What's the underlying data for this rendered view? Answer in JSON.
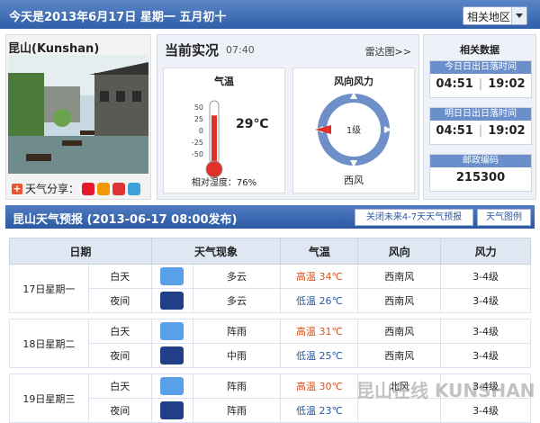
{
  "header": {
    "date_text": "今天是2013年6月17日  星期一  五月初十",
    "region_select": "相关地区"
  },
  "city": {
    "name": "昆山(Kunshan)",
    "share_label": "天气分享："
  },
  "now": {
    "title": "当前实况",
    "time": "07:40",
    "radar_link": "雷达图>>",
    "temp_title": "气温",
    "temp_value": "29℃",
    "temp_ticks": [
      "50",
      "25",
      "0",
      "-25",
      "-50"
    ],
    "humidity": "相对湿度：76%",
    "wind_title": "风向风力",
    "wind_level": "1级",
    "wind_dir": "西风",
    "temp_fraction": 0.79
  },
  "related": {
    "title": "相关数据",
    "sun_today_label": "今日日出日落时间",
    "sunrise_today": "04:51",
    "sunset_today": "19:02",
    "sun_tomorrow_label": "明日日出日落时间",
    "sunrise_tomorrow": "04:51",
    "sunset_tomorrow": "19:02",
    "zip_label": "邮政编码",
    "zip": "215300"
  },
  "forecast": {
    "title": "昆山天气预报  (2013-06-17  08:00发布)",
    "btn_close": "关闭未来4-7天天气预报",
    "btn_legend": "天气图例",
    "headers": {
      "date": "日期",
      "phenomenon": "天气现象",
      "temp": "气温",
      "wind_dir": "风向",
      "wind_force": "风力"
    },
    "days": [
      {
        "date": "17日星期一",
        "day": {
          "period": "白天",
          "icon": "partly-cloudy-day-icon",
          "weather": "多云",
          "temp_label": "高温",
          "temp": "34℃",
          "wind_dir": "西南风",
          "wind_force": "3-4级"
        },
        "night": {
          "period": "夜间",
          "icon": "cloudy-night-icon",
          "weather": "多云",
          "temp_label": "低温",
          "temp": "26℃",
          "wind_dir": "西南风",
          "wind_force": "3-4级"
        }
      },
      {
        "date": "18日星期二",
        "day": {
          "period": "白天",
          "icon": "shower-icon",
          "weather": "阵雨",
          "temp_label": "高温",
          "temp": "31℃",
          "wind_dir": "西南风",
          "wind_force": "3-4级"
        },
        "night": {
          "period": "夜间",
          "icon": "moderate-rain-icon",
          "weather": "中雨",
          "temp_label": "低温",
          "temp": "25℃",
          "wind_dir": "西南风",
          "wind_force": "3-4级"
        }
      },
      {
        "date": "19日星期三",
        "day": {
          "period": "白天",
          "icon": "shower-icon",
          "weather": "阵雨",
          "temp_label": "高温",
          "temp": "30℃",
          "wind_dir": "北风",
          "wind_force": "3-4级"
        },
        "night": {
          "period": "夜间",
          "icon": "shower-night-icon",
          "weather": "阵雨",
          "temp_label": "低温",
          "temp": "23℃",
          "wind_dir": "",
          "wind_force": "3-4级"
        }
      }
    ]
  },
  "watermark": "昆山在线 KUNSHAN BBS",
  "colors": {
    "header_blue": "#2f5fa8",
    "high_temp": "#d9541e",
    "low_temp": "#2b5aa3",
    "thermo_red": "#e0302a"
  }
}
